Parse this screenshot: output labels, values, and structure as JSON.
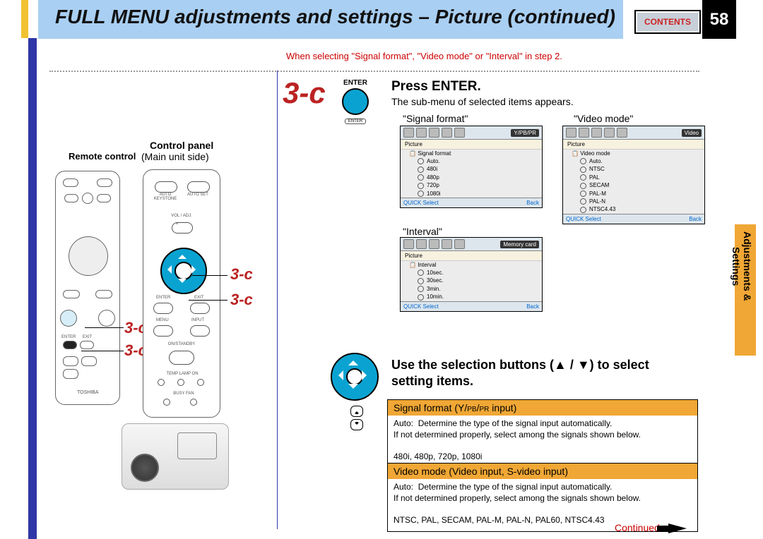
{
  "header": {
    "title": "FULL MENU adjustments and settings – Picture (continued)",
    "contents_btn": "CONTENTS",
    "page_number": "58"
  },
  "side_tab": "Adjustments &\nSettings",
  "top_note": "When selecting \"Signal format\", \"Video mode\" or \"Interval\"  in step 2.",
  "step_label": "3-c",
  "enter_block": {
    "top_label": "ENTER",
    "bottom_label": "ENTER",
    "heading": "Press ENTER.",
    "desc": "The sub-menu of selected items appears."
  },
  "left_panel": {
    "remote": "Remote control",
    "control": "Control panel",
    "main_unit": "(Main unit side)",
    "panel_labels": {
      "auto_keystone": "AUTO KEYSTONE",
      "auto_set": "AUTO SET",
      "vol": "VOL / ADJ.",
      "enter": "ENTER",
      "exit": "EXIT",
      "menu": "MENU",
      "input": "INPUT",
      "standby": "ON/STANDBY",
      "led": "TEMP  LAMP   ON",
      "busy_fan": "BUSY       FAN"
    }
  },
  "submenu": {
    "signal_format": {
      "label": "\"Signal format\"",
      "badge": "Y/PB/PR",
      "section": "Picture",
      "name": "Signal format",
      "options": [
        "Auto.",
        "480i",
        "480p",
        "720p",
        "1080i"
      ],
      "foot_left": "QUICK   Select",
      "foot_right": "Back"
    },
    "video_mode": {
      "label": "\"Video mode\"",
      "badge": "Video",
      "section": "Picture",
      "name": "Video mode",
      "options": [
        "Auto.",
        "NTSC",
        "PAL",
        "SECAM",
        "PAL-M",
        "PAL-N",
        "NTSC4.43"
      ],
      "foot_left": "QUICK   Select",
      "foot_right": "Back"
    },
    "interval": {
      "label": "\"Interval\"",
      "badge": "Memory card",
      "section": "Picture",
      "name": "Interval",
      "options": [
        "10sec.",
        "30sec.",
        "3min.",
        "10min."
      ],
      "foot_left": "QUICK   Select",
      "foot_right": "Back"
    }
  },
  "selection_heading": "Use the selection buttons (▲ / ▼) to select setting items.",
  "info1": {
    "title_main": "Signal format (Y/",
    "title_sub1": "PB",
    "title_mid": "/",
    "title_sub2": "PR",
    "title_end": " input)",
    "auto": "Auto:",
    "auto_desc": "Determine the type of the signal input automatically.",
    "line2": "If not determined properly, select among the signals shown below.",
    "signals": "480i, 480p, 720p, 1080i"
  },
  "info2": {
    "title": "Video mode (Video input, S-video input)",
    "auto": "Auto:",
    "auto_desc": "Determine the type of the signal input automatically.",
    "line2": "If not determined properly, select among the signals shown below.",
    "signals": "NTSC, PAL, SECAM, PAL-M, PAL-N, PAL60, NTSC4.43"
  },
  "continued": "Continued"
}
